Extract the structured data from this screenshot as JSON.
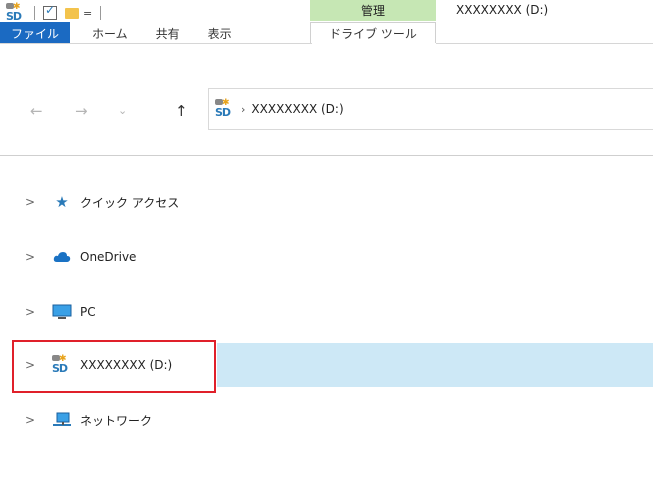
{
  "titlebar": {
    "title": "XXXXXXXX (D:)",
    "context_group": "管理",
    "qat_dropdown": "="
  },
  "ribbon": {
    "tabs": [
      "ファイル",
      "ホーム",
      "共有",
      "表示"
    ],
    "context_tab": "ドライブ ツール"
  },
  "address_bar": {
    "path": "XXXXXXXX (D:)"
  },
  "nav_buttons": {
    "back": "←",
    "forward": "→",
    "recent": "⌄",
    "up": "↑"
  },
  "tree": {
    "items": [
      {
        "label": "クイック アクセス",
        "icon": "quick-access-star-icon",
        "expand": ">"
      },
      {
        "label": "OneDrive",
        "icon": "onedrive-cloud-icon",
        "expand": ">"
      },
      {
        "label": "PC",
        "icon": "pc-monitor-icon",
        "expand": ">"
      },
      {
        "label": "XXXXXXXX (D:)",
        "icon": "sd-card-drive-icon",
        "expand": ">",
        "selected": true
      },
      {
        "label": "ネットワーク",
        "icon": "network-icon",
        "expand": ">"
      }
    ]
  },
  "colors": {
    "file_tab": "#1b6ac2",
    "context_group": "#c6e7b4",
    "selection": "#cde8f6",
    "highlight_box": "#e0202a",
    "star": "#2a7ab8"
  }
}
